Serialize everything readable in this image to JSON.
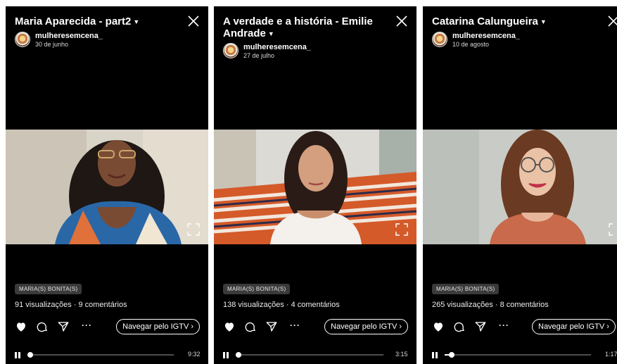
{
  "panels": [
    {
      "title": "Maria Aparecida - part2",
      "username": "mulheresemcena_",
      "date": "30 de junho",
      "tag": "MARIA(S) BONITA(S)",
      "stats": "91 visualizações · 9 comentários",
      "browse_label": "Navegar pelo IGTV ›",
      "time": "9:32",
      "progress": 0.02,
      "icons": [
        "caret-down-icon",
        "close-icon",
        "heart-icon",
        "comment-icon",
        "share-icon",
        "more-icon",
        "expand-icon",
        "pause-icon"
      ]
    },
    {
      "title": "A verdade e a história - Emilie Andrade",
      "username": "mulheresemcena_",
      "date": "27 de julho",
      "tag": "MARIA(S) BONITA(S)",
      "stats": "138 visualizações · 4 comentários",
      "browse_label": "Navegar pelo IGTV ›",
      "time": "3:15",
      "progress": 0.02,
      "icons": [
        "caret-down-icon",
        "close-icon",
        "heart-icon",
        "comment-icon",
        "share-icon",
        "more-icon",
        "expand-icon",
        "pause-icon"
      ]
    },
    {
      "title": "Catarina Calungueira",
      "username": "mulheresemcena_",
      "date": "10 de agosto",
      "tag": "MARIA(S) BONITA(S)",
      "stats": "265 visualizações · 8 comentários",
      "browse_label": "Navegar pelo IGTV ›",
      "time": "1:17",
      "progress": 0.05,
      "icons": [
        "caret-down-icon",
        "close-icon",
        "heart-icon",
        "comment-icon",
        "share-icon",
        "more-icon",
        "expand-icon",
        "pause-icon"
      ]
    }
  ],
  "colors": {
    "background": "#000000",
    "text": "#ffffff",
    "tag_bg": "#3a3a3a",
    "track": "#4d4d4d"
  }
}
